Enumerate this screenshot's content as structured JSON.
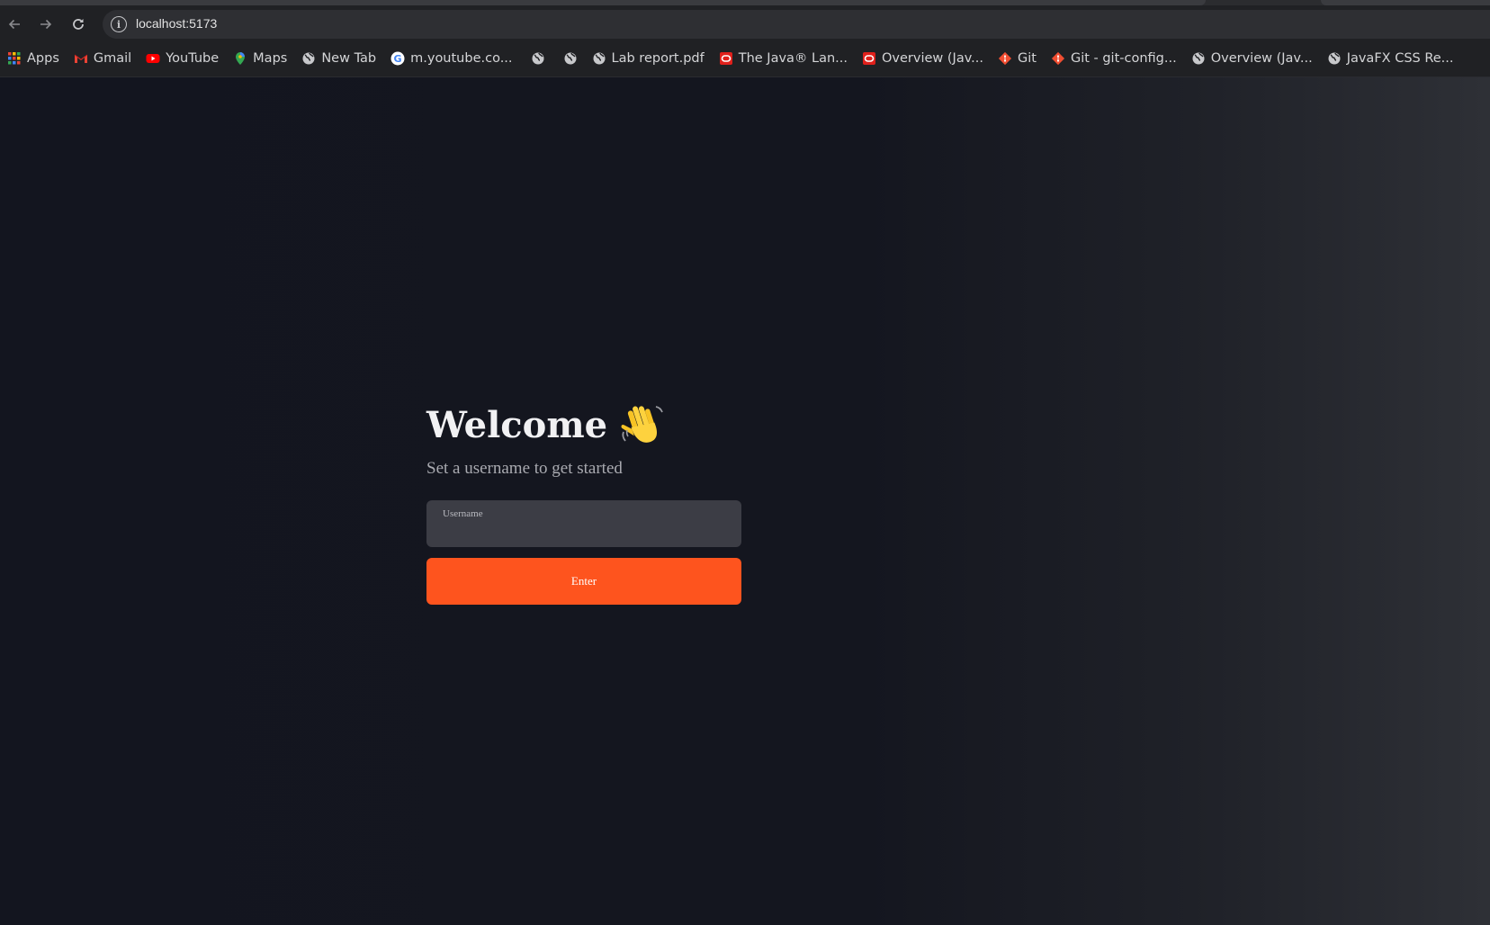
{
  "browser": {
    "url": "localhost:5173",
    "bookmarks": [
      {
        "label": "Apps",
        "icon": "apps-grid-icon"
      },
      {
        "label": "Gmail",
        "icon": "gmail-icon"
      },
      {
        "label": "YouTube",
        "icon": "youtube-icon"
      },
      {
        "label": "Maps",
        "icon": "maps-icon"
      },
      {
        "label": "New Tab",
        "icon": "globe-icon"
      },
      {
        "label": "m.youtube.co...",
        "icon": "google-icon"
      },
      {
        "label": "",
        "icon": "globe-icon"
      },
      {
        "label": "",
        "icon": "globe-icon"
      },
      {
        "label": "Lab report.pdf",
        "icon": "globe-icon"
      },
      {
        "label": "The Java® Lan...",
        "icon": "oracle-icon"
      },
      {
        "label": "Overview (Jav...",
        "icon": "oracle-icon"
      },
      {
        "label": "Git",
        "icon": "git-icon"
      },
      {
        "label": "Git - git-config...",
        "icon": "git-icon"
      },
      {
        "label": "Overview (Jav...",
        "icon": "globe-icon"
      },
      {
        "label": "JavaFX CSS Re...",
        "icon": "globe-icon"
      }
    ]
  },
  "login": {
    "title": "Welcome",
    "subtitle": "Set a username to get started",
    "username_label": "Username",
    "username_value": "",
    "enter_label": "Enter"
  },
  "colors": {
    "background": "#13151f",
    "accent": "#fe541e",
    "field": "#3c3d45"
  }
}
